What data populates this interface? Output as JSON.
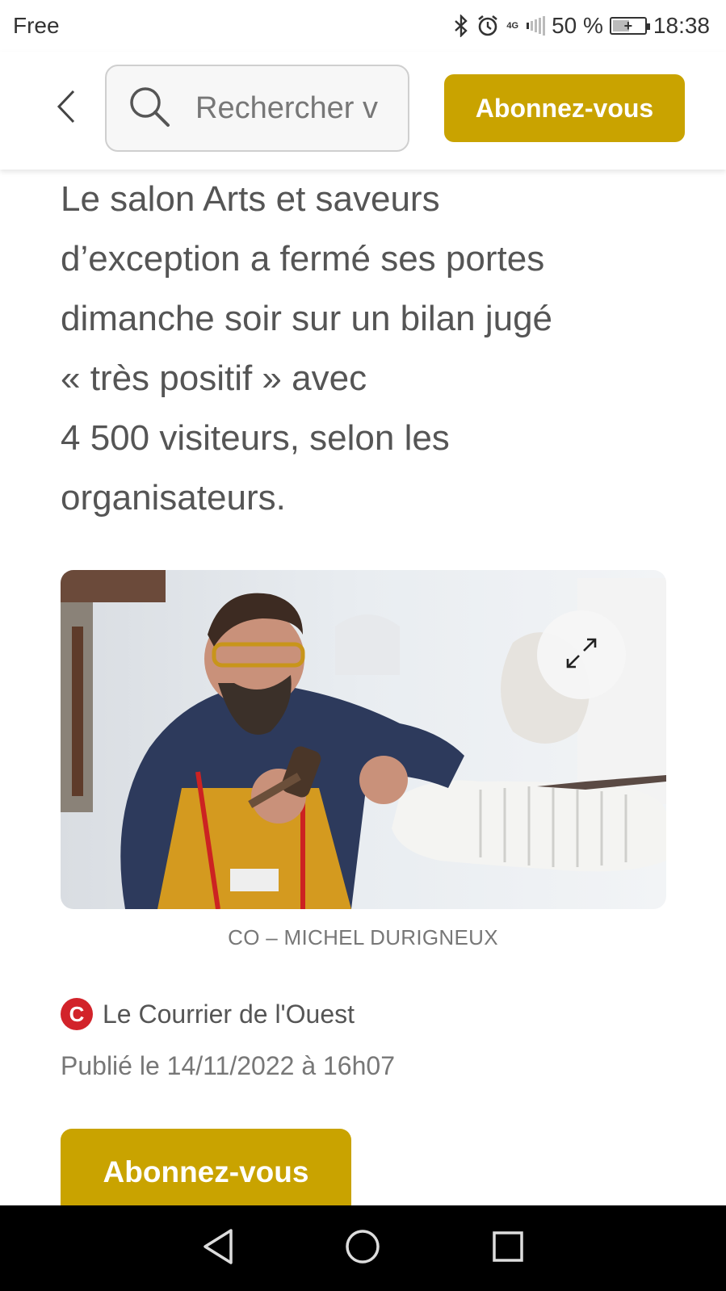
{
  "status_bar": {
    "carrier": "Free",
    "network": "4G",
    "battery_percent": "50 %",
    "time": "18:38"
  },
  "header": {
    "search_placeholder": "Rechercher v",
    "subscribe_label": "Abonnez-vous"
  },
  "article": {
    "lead_lines": [
      "Le salon Arts et saveurs",
      "d’exception a fermé ses portes",
      "dimanche soir sur un bilan jugé",
      "« très positif » avec",
      "4 500 visiteurs, selon les",
      "organisateurs."
    ],
    "photo_credit": "CO – MICHEL DURIGNEUX",
    "source_logo_letter": "C",
    "source_name": "Le Courrier de l'Ouest",
    "published": "Publié le 14/11/2022 à 16h07",
    "subscribe_label": "Abonnez-vous"
  },
  "colors": {
    "accent": "#c9a300",
    "source_logo": "#d2232a"
  }
}
